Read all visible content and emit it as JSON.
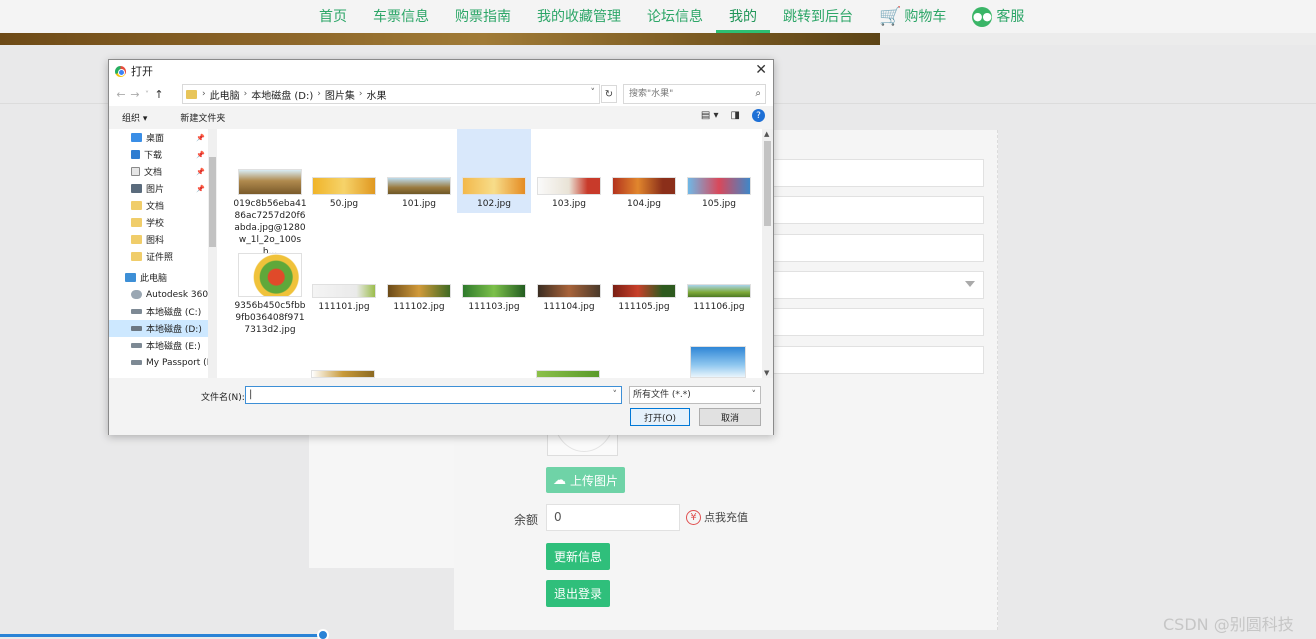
{
  "nav": {
    "items": [
      "首页",
      "车票信息",
      "购票指南",
      "我的收藏管理",
      "论坛信息",
      "我的",
      "跳转到后台"
    ],
    "cart_label": "购物车",
    "service_label": "客服",
    "active_index": 5,
    "accent_color": "#2da668"
  },
  "form": {
    "upload_label": "上传图片",
    "balance_label": "余额",
    "balance_value": "0",
    "recharge_label": "点我充值",
    "update_label": "更新信息",
    "logout_label": "退出登录"
  },
  "dialog": {
    "title": "打开",
    "breadcrumbs": [
      "此电脑",
      "本地磁盘 (D:)",
      "图片集",
      "水果"
    ],
    "search_placeholder": "搜索\"水果\"",
    "toolbar": {
      "organize": "组织 ▾",
      "new_folder": "新建文件夹"
    },
    "sidebar": [
      {
        "label": "桌面",
        "icon": "desktop-icon",
        "pinned": true
      },
      {
        "label": "下载",
        "icon": "download-icon",
        "pinned": true
      },
      {
        "label": "文档",
        "icon": "document-icon",
        "pinned": true
      },
      {
        "label": "图片",
        "icon": "picture-icon",
        "pinned": true
      },
      {
        "label": "文档",
        "icon": "folder-icon",
        "pinned": false
      },
      {
        "label": "学校",
        "icon": "folder-icon",
        "pinned": false
      },
      {
        "label": "图科",
        "icon": "folder-icon",
        "pinned": false
      },
      {
        "label": "证件照",
        "icon": "folder-icon",
        "pinned": false
      },
      {
        "label": "此电脑",
        "icon": "computer-icon",
        "pinned": false
      },
      {
        "label": "Autodesk 360",
        "icon": "cloud-drive-icon",
        "pinned": false
      },
      {
        "label": "本地磁盘 (C:)",
        "icon": "drive-icon",
        "pinned": false
      },
      {
        "label": "本地磁盘 (D:)",
        "icon": "drive-icon",
        "pinned": false,
        "selected": true
      },
      {
        "label": "本地磁盘 (E:)",
        "icon": "drive-icon",
        "pinned": false
      },
      {
        "label": "My Passport (F",
        "icon": "drive-icon",
        "pinned": false
      }
    ],
    "files_row1": [
      "019c8b56eba4186ac7257d20f6abda.jpg@1280w_1l_2o_100sh...",
      "50.jpg",
      "101.jpg",
      "102.jpg",
      "103.jpg",
      "104.jpg",
      "105.jpg"
    ],
    "files_row2": [
      "9356b450c5fbb9fb036408f9717313d2.jpg",
      "111101.jpg",
      "111102.jpg",
      "111103.jpg",
      "111104.jpg",
      "111105.jpg",
      "111106.jpg"
    ],
    "selected_file_index": 3,
    "filename_label": "文件名(N):",
    "filename_value": "",
    "filter_value": "所有文件 (*.*)",
    "open_label": "打开(O)",
    "cancel_label": "取消"
  },
  "watermark": "CSDN @别圆科技"
}
